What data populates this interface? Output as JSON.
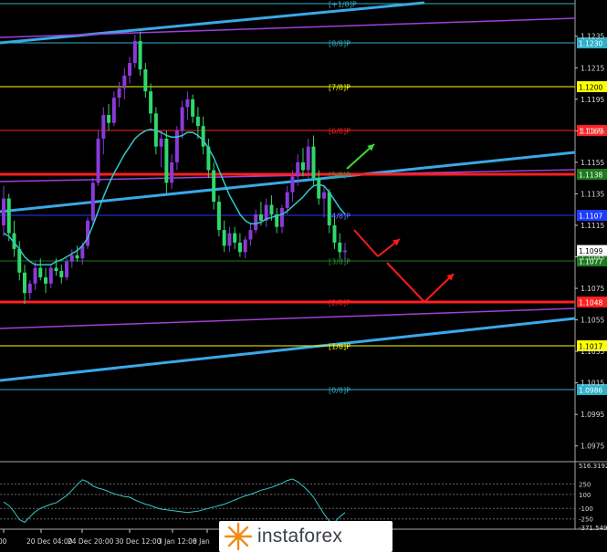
{
  "chart_data": {
    "type": "candlestick",
    "instrument_hint": "EUR/USD",
    "price_axis": {
      "range": [
        1.0965,
        1.1258
      ],
      "labels": [
        "1.1235",
        "1.1215",
        "1.1195",
        "1.1175",
        "1.1155",
        "1.1135",
        "1.1115",
        "1.1095",
        "1.1075",
        "1.1055",
        "1.1035",
        "1.1015",
        "1.0995",
        "1.0975"
      ],
      "current_price": "1.1099"
    },
    "time_axis": {
      "labels": [
        "00",
        "20 Dec 04:00",
        "24 Dec 20:00",
        "30 Dec 12:00",
        "3 Jan 12:00",
        "8 Jan"
      ]
    },
    "murrey_levels": [
      {
        "label": "[+1/8]P",
        "price": "",
        "color": "#2fb0c8"
      },
      {
        "label": "[8/8]P",
        "price": "1.1230",
        "color": "#2fb0c8"
      },
      {
        "label": "[7/8]P",
        "price": "1.1200",
        "color": "#ffff00"
      },
      {
        "label": "[6/8]P",
        "price": "1.1169",
        "color": "#ff2020"
      },
      {
        "label": "[5/8]P",
        "price": "1.1138",
        "color": "#1e7a1e"
      },
      {
        "label": "[4/8]P",
        "price": "1.1107",
        "color": "#1e3cff"
      },
      {
        "label": "[3/8]P",
        "price": "1.1077",
        "color": "#1e7a1e"
      },
      {
        "label": "[2/8]P",
        "price": "1.1048",
        "color": "#ff2020"
      },
      {
        "label": "[1/8]P",
        "price": "1.1017",
        "color": "#ffff00"
      },
      {
        "label": "[0/8]P",
        "price": "1.0986",
        "color": "#2fb0c8"
      }
    ],
    "candles": [
      [
        1.1115,
        1.114,
        1.1108,
        1.1132
      ],
      [
        1.1132,
        1.1135,
        1.1105,
        1.111
      ],
      [
        1.111,
        1.1118,
        1.1095,
        1.11
      ],
      [
        1.11,
        1.1105,
        1.108,
        1.1085
      ],
      [
        1.1085,
        1.109,
        1.1065,
        1.1072
      ],
      [
        1.1072,
        1.108,
        1.1068,
        1.1078
      ],
      [
        1.1078,
        1.1092,
        1.1074,
        1.1088
      ],
      [
        1.1088,
        1.1094,
        1.108,
        1.1082
      ],
      [
        1.1082,
        1.1088,
        1.1072,
        1.1078
      ],
      [
        1.1078,
        1.109,
        1.1075,
        1.1088
      ],
      [
        1.1088,
        1.1094,
        1.1083,
        1.1086
      ],
      [
        1.1086,
        1.109,
        1.1078,
        1.1082
      ],
      [
        1.1082,
        1.1094,
        1.108,
        1.1092
      ],
      [
        1.1092,
        1.11,
        1.1088,
        1.1096
      ],
      [
        1.1096,
        1.1102,
        1.1092,
        1.1094
      ],
      [
        1.1094,
        1.1104,
        1.109,
        1.1102
      ],
      [
        1.1102,
        1.112,
        1.11,
        1.1118
      ],
      [
        1.1118,
        1.1145,
        1.1115,
        1.1142
      ],
      [
        1.1142,
        1.1175,
        1.114,
        1.117
      ],
      [
        1.117,
        1.119,
        1.116,
        1.1185
      ],
      [
        1.1185,
        1.1192,
        1.1175,
        1.118
      ],
      [
        1.118,
        1.12,
        1.1178,
        1.1196
      ],
      [
        1.1196,
        1.1206,
        1.119,
        1.1202
      ],
      [
        1.1202,
        1.1215,
        1.1195,
        1.121
      ],
      [
        1.121,
        1.1222,
        1.1205,
        1.1218
      ],
      [
        1.1218,
        1.1236,
        1.1215,
        1.1232
      ],
      [
        1.1232,
        1.1238,
        1.121,
        1.1214
      ],
      [
        1.1214,
        1.1218,
        1.1196,
        1.12
      ],
      [
        1.12,
        1.1205,
        1.118,
        1.1186
      ],
      [
        1.1186,
        1.119,
        1.116,
        1.1165
      ],
      [
        1.1165,
        1.1175,
        1.1152,
        1.117
      ],
      [
        1.117,
        1.1175,
        1.1135,
        1.1142
      ],
      [
        1.1142,
        1.116,
        1.1138,
        1.1155
      ],
      [
        1.1155,
        1.1178,
        1.115,
        1.1175
      ],
      [
        1.1175,
        1.1194,
        1.117,
        1.119
      ],
      [
        1.119,
        1.12,
        1.1182,
        1.1195
      ],
      [
        1.1195,
        1.1198,
        1.118,
        1.1184
      ],
      [
        1.1184,
        1.119,
        1.117,
        1.1178
      ],
      [
        1.1178,
        1.1184,
        1.116,
        1.1165
      ],
      [
        1.1165,
        1.117,
        1.1145,
        1.115
      ],
      [
        1.115,
        1.1155,
        1.1125,
        1.113
      ],
      [
        1.113,
        1.1134,
        1.1108,
        1.1112
      ],
      [
        1.1112,
        1.1118,
        1.1098,
        1.1102
      ],
      [
        1.1102,
        1.1114,
        1.1098,
        1.111
      ],
      [
        1.111,
        1.1114,
        1.11,
        1.1104
      ],
      [
        1.1104,
        1.111,
        1.1095,
        1.1098
      ],
      [
        1.1098,
        1.1108,
        1.1094,
        1.1106
      ],
      [
        1.1106,
        1.1116,
        1.1102,
        1.1112
      ],
      [
        1.1112,
        1.1125,
        1.111,
        1.1122
      ],
      [
        1.1122,
        1.113,
        1.1115,
        1.1118
      ],
      [
        1.1118,
        1.1132,
        1.1114,
        1.1128
      ],
      [
        1.1128,
        1.1134,
        1.1118,
        1.1122
      ],
      [
        1.1122,
        1.1126,
        1.111,
        1.1114
      ],
      [
        1.1114,
        1.1128,
        1.111,
        1.1126
      ],
      [
        1.1126,
        1.114,
        1.1122,
        1.1136
      ],
      [
        1.1136,
        1.115,
        1.113,
        1.1146
      ],
      [
        1.1146,
        1.116,
        1.114,
        1.1155
      ],
      [
        1.1155,
        1.1164,
        1.1146,
        1.115
      ],
      [
        1.115,
        1.117,
        1.1145,
        1.1165
      ],
      [
        1.1165,
        1.1172,
        1.114,
        1.1145
      ],
      [
        1.1145,
        1.115,
        1.1128,
        1.1132
      ],
      [
        1.1132,
        1.114,
        1.112,
        1.1136
      ],
      [
        1.1136,
        1.1138,
        1.111,
        1.1115
      ],
      [
        1.1115,
        1.112,
        1.11,
        1.1104
      ],
      [
        1.1104,
        1.111,
        1.1094,
        1.1098
      ],
      [
        1.1098,
        1.1104,
        1.1092,
        1.1099
      ]
    ],
    "ma_line": [
      1.111,
      1.1108,
      1.1104,
      1.11,
      1.1095,
      1.1092,
      1.109,
      1.109,
      1.109,
      1.109,
      1.1092,
      1.1093,
      1.1095,
      1.1097,
      1.1099,
      1.1102,
      1.1107,
      1.1115,
      1.1124,
      1.1133,
      1.1141,
      1.1148,
      1.1154,
      1.116,
      1.1165,
      1.117,
      1.1173,
      1.1175,
      1.1176,
      1.1175,
      1.1174,
      1.1172,
      1.1171,
      1.1171,
      1.1172,
      1.1174,
      1.1174,
      1.1172,
      1.1169,
      1.1164,
      1.1158,
      1.115,
      1.1142,
      1.1134,
      1.1128,
      1.1122,
      1.1118,
      1.1116,
      1.1116,
      1.1117,
      1.1119,
      1.112,
      1.1121,
      1.1122,
      1.1124,
      1.1127,
      1.113,
      1.1133,
      1.1137,
      1.114,
      1.1141,
      1.114,
      1.1136,
      1.1131,
      1.1126,
      1.1122
    ],
    "oscillator": {
      "labels": [
        "516.3192",
        "250",
        "100",
        "-100",
        "-250",
        "-371.5494"
      ],
      "levels": [
        250,
        100,
        -100,
        -250
      ],
      "range": [
        -371.5494,
        516.3192
      ],
      "values": [
        -10,
        -60,
        -150,
        -260,
        -300,
        -220,
        -150,
        -100,
        -70,
        -40,
        -20,
        30,
        80,
        160,
        240,
        310,
        280,
        220,
        190,
        170,
        140,
        110,
        90,
        70,
        60,
        20,
        -10,
        -40,
        -60,
        -90,
        -110,
        -120,
        -130,
        -140,
        -150,
        -160,
        -150,
        -140,
        -120,
        -100,
        -80,
        -60,
        -40,
        -10,
        20,
        50,
        80,
        100,
        130,
        160,
        180,
        200,
        230,
        260,
        300,
        320,
        280,
        220,
        150,
        60,
        -60,
        -180,
        -280,
        -300,
        -220,
        -160
      ]
    }
  },
  "watermark": {
    "text": "instaforex"
  }
}
